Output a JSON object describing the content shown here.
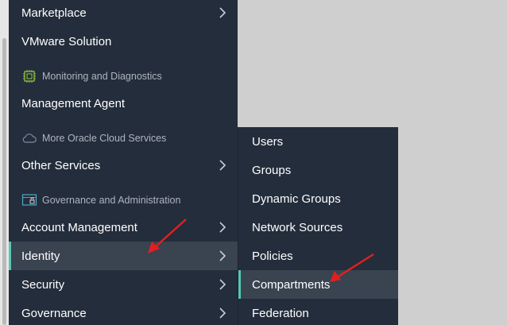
{
  "menu": {
    "items": [
      {
        "label": "Marketplace"
      },
      {
        "label": "VMware Solution"
      },
      {
        "label": "Management Agent"
      },
      {
        "label": "Other Services"
      },
      {
        "label": "Account Management"
      },
      {
        "label": "Identity"
      },
      {
        "label": "Security"
      },
      {
        "label": "Governance"
      }
    ],
    "sections": [
      {
        "label": "Monitoring and Diagnostics",
        "icon": "chip-icon"
      },
      {
        "label": "More Oracle Cloud Services",
        "icon": "cloud-icon"
      },
      {
        "label": "Governance and Administration",
        "icon": "admin-console-icon"
      }
    ],
    "active_item": "Identity"
  },
  "submenu": {
    "items": [
      {
        "label": "Users"
      },
      {
        "label": "Groups"
      },
      {
        "label": "Dynamic Groups"
      },
      {
        "label": "Network Sources"
      },
      {
        "label": "Policies"
      },
      {
        "label": "Compartments"
      },
      {
        "label": "Federation"
      }
    ],
    "active_item": "Compartments"
  },
  "colors": {
    "menu_bg": "#242d3b",
    "active_bg": "#3a4350",
    "accent": "#58c7b0",
    "annotation_arrow": "#e02020"
  }
}
